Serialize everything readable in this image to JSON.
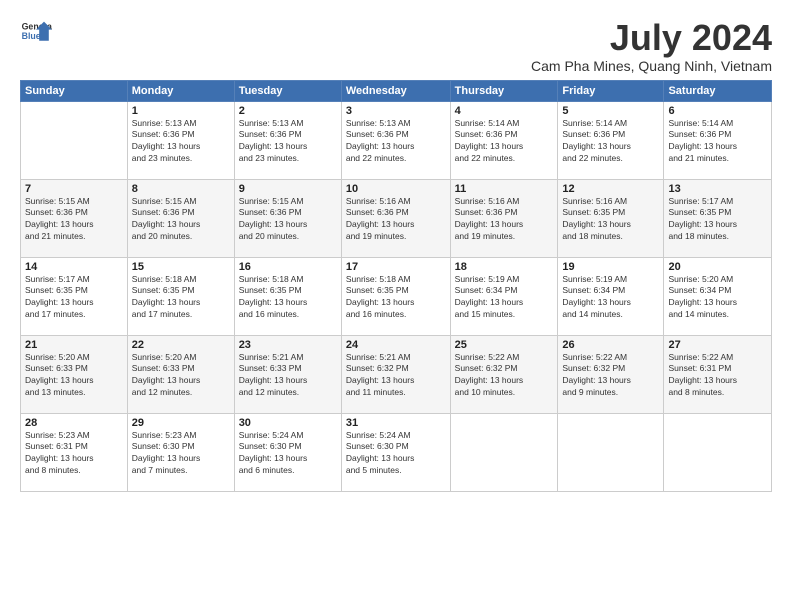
{
  "header": {
    "logo_line1": "General",
    "logo_line2": "Blue",
    "month_year": "July 2024",
    "location": "Cam Pha Mines, Quang Ninh, Vietnam"
  },
  "weekdays": [
    "Sunday",
    "Monday",
    "Tuesday",
    "Wednesday",
    "Thursday",
    "Friday",
    "Saturday"
  ],
  "weeks": [
    [
      {
        "day": "",
        "info": ""
      },
      {
        "day": "1",
        "info": "Sunrise: 5:13 AM\nSunset: 6:36 PM\nDaylight: 13 hours\nand 23 minutes."
      },
      {
        "day": "2",
        "info": "Sunrise: 5:13 AM\nSunset: 6:36 PM\nDaylight: 13 hours\nand 23 minutes."
      },
      {
        "day": "3",
        "info": "Sunrise: 5:13 AM\nSunset: 6:36 PM\nDaylight: 13 hours\nand 22 minutes."
      },
      {
        "day": "4",
        "info": "Sunrise: 5:14 AM\nSunset: 6:36 PM\nDaylight: 13 hours\nand 22 minutes."
      },
      {
        "day": "5",
        "info": "Sunrise: 5:14 AM\nSunset: 6:36 PM\nDaylight: 13 hours\nand 22 minutes."
      },
      {
        "day": "6",
        "info": "Sunrise: 5:14 AM\nSunset: 6:36 PM\nDaylight: 13 hours\nand 21 minutes."
      }
    ],
    [
      {
        "day": "7",
        "info": "Sunrise: 5:15 AM\nSunset: 6:36 PM\nDaylight: 13 hours\nand 21 minutes."
      },
      {
        "day": "8",
        "info": "Sunrise: 5:15 AM\nSunset: 6:36 PM\nDaylight: 13 hours\nand 20 minutes."
      },
      {
        "day": "9",
        "info": "Sunrise: 5:15 AM\nSunset: 6:36 PM\nDaylight: 13 hours\nand 20 minutes."
      },
      {
        "day": "10",
        "info": "Sunrise: 5:16 AM\nSunset: 6:36 PM\nDaylight: 13 hours\nand 19 minutes."
      },
      {
        "day": "11",
        "info": "Sunrise: 5:16 AM\nSunset: 6:36 PM\nDaylight: 13 hours\nand 19 minutes."
      },
      {
        "day": "12",
        "info": "Sunrise: 5:16 AM\nSunset: 6:35 PM\nDaylight: 13 hours\nand 18 minutes."
      },
      {
        "day": "13",
        "info": "Sunrise: 5:17 AM\nSunset: 6:35 PM\nDaylight: 13 hours\nand 18 minutes."
      }
    ],
    [
      {
        "day": "14",
        "info": "Sunrise: 5:17 AM\nSunset: 6:35 PM\nDaylight: 13 hours\nand 17 minutes."
      },
      {
        "day": "15",
        "info": "Sunrise: 5:18 AM\nSunset: 6:35 PM\nDaylight: 13 hours\nand 17 minutes."
      },
      {
        "day": "16",
        "info": "Sunrise: 5:18 AM\nSunset: 6:35 PM\nDaylight: 13 hours\nand 16 minutes."
      },
      {
        "day": "17",
        "info": "Sunrise: 5:18 AM\nSunset: 6:35 PM\nDaylight: 13 hours\nand 16 minutes."
      },
      {
        "day": "18",
        "info": "Sunrise: 5:19 AM\nSunset: 6:34 PM\nDaylight: 13 hours\nand 15 minutes."
      },
      {
        "day": "19",
        "info": "Sunrise: 5:19 AM\nSunset: 6:34 PM\nDaylight: 13 hours\nand 14 minutes."
      },
      {
        "day": "20",
        "info": "Sunrise: 5:20 AM\nSunset: 6:34 PM\nDaylight: 13 hours\nand 14 minutes."
      }
    ],
    [
      {
        "day": "21",
        "info": "Sunrise: 5:20 AM\nSunset: 6:33 PM\nDaylight: 13 hours\nand 13 minutes."
      },
      {
        "day": "22",
        "info": "Sunrise: 5:20 AM\nSunset: 6:33 PM\nDaylight: 13 hours\nand 12 minutes."
      },
      {
        "day": "23",
        "info": "Sunrise: 5:21 AM\nSunset: 6:33 PM\nDaylight: 13 hours\nand 12 minutes."
      },
      {
        "day": "24",
        "info": "Sunrise: 5:21 AM\nSunset: 6:32 PM\nDaylight: 13 hours\nand 11 minutes."
      },
      {
        "day": "25",
        "info": "Sunrise: 5:22 AM\nSunset: 6:32 PM\nDaylight: 13 hours\nand 10 minutes."
      },
      {
        "day": "26",
        "info": "Sunrise: 5:22 AM\nSunset: 6:32 PM\nDaylight: 13 hours\nand 9 minutes."
      },
      {
        "day": "27",
        "info": "Sunrise: 5:22 AM\nSunset: 6:31 PM\nDaylight: 13 hours\nand 8 minutes."
      }
    ],
    [
      {
        "day": "28",
        "info": "Sunrise: 5:23 AM\nSunset: 6:31 PM\nDaylight: 13 hours\nand 8 minutes."
      },
      {
        "day": "29",
        "info": "Sunrise: 5:23 AM\nSunset: 6:30 PM\nDaylight: 13 hours\nand 7 minutes."
      },
      {
        "day": "30",
        "info": "Sunrise: 5:24 AM\nSunset: 6:30 PM\nDaylight: 13 hours\nand 6 minutes."
      },
      {
        "day": "31",
        "info": "Sunrise: 5:24 AM\nSunset: 6:30 PM\nDaylight: 13 hours\nand 5 minutes."
      },
      {
        "day": "",
        "info": ""
      },
      {
        "day": "",
        "info": ""
      },
      {
        "day": "",
        "info": ""
      }
    ]
  ]
}
